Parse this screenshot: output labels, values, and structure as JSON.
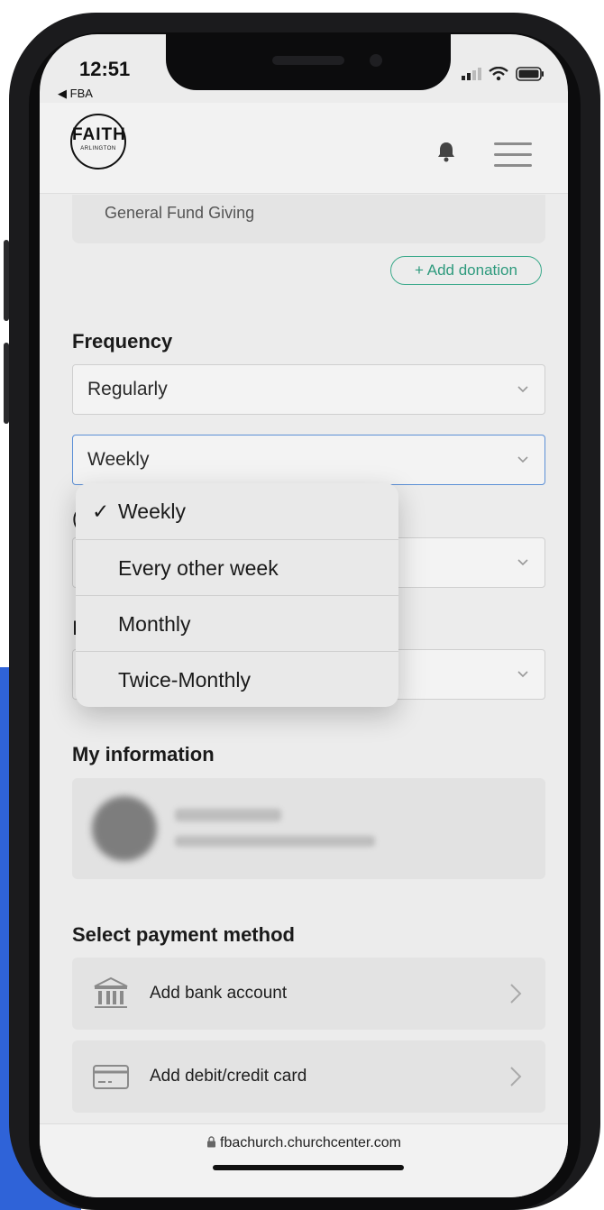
{
  "status": {
    "time": "12:51",
    "back_app": "FBA"
  },
  "header": {
    "logo_line1": "FAITH",
    "logo_line2": "ARLINGTON"
  },
  "fund": {
    "name": "General Fund Giving"
  },
  "add_donation_label": "+ Add donation",
  "frequency": {
    "title": "Frequency",
    "type_value": "Regularly",
    "interval_value": "Weekly",
    "dropdown_options": [
      {
        "label": "Weekly",
        "selected": true
      },
      {
        "label": "Every other week",
        "selected": false
      },
      {
        "label": "Monthly",
        "selected": false
      },
      {
        "label": "Twice-Monthly",
        "selected": false
      }
    ],
    "check_glyph": "✓"
  },
  "obscured_label_1": "(",
  "obscured_label_2": "I",
  "my_information": {
    "title": "My information"
  },
  "payment": {
    "title": "Select payment method",
    "bank_label": "Add bank account",
    "card_label": "Add debit/credit card"
  },
  "browser": {
    "url": "fbachurch.churchcenter.com"
  },
  "colors": {
    "accent_green": "#3aa98a",
    "focus_blue": "#5b8fd6",
    "backdrop_blue": "#2f63d8"
  },
  "icons": [
    "back-arrow-icon",
    "signal-icon",
    "wifi-icon",
    "battery-icon",
    "bell-icon",
    "hamburger-menu-icon",
    "chevron-down-icon",
    "checkmark-icon",
    "bank-icon",
    "credit-card-icon",
    "chevron-right-icon",
    "lock-icon"
  ]
}
